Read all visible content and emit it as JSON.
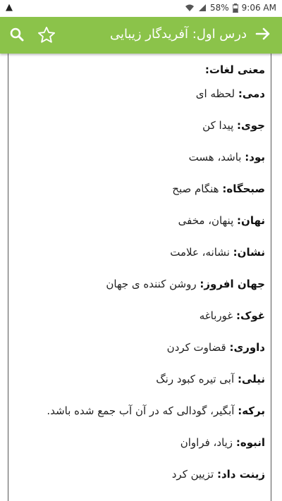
{
  "status_bar": {
    "battery": "58%",
    "time": "9:06 AM"
  },
  "app_bar": {
    "title": "درس اول: آفریدگار زیبایی",
    "color": "#8bc34a"
  },
  "content": {
    "heading": "معنی لغات:",
    "entries": [
      {
        "term": "دمی:",
        "meaning": "لحظه ای"
      },
      {
        "term": "جوی:",
        "meaning": "پیدا کن"
      },
      {
        "term": "بود:",
        "meaning": "باشد، هست"
      },
      {
        "term": "صبحگاه:",
        "meaning": "هنگام صبح"
      },
      {
        "term": "نهان:",
        "meaning": "پنهان، مخفی"
      },
      {
        "term": "نشان:",
        "meaning": "نشانه، علامت"
      },
      {
        "term": "جهان افروز:",
        "meaning": "روشن کننده ی جهان"
      },
      {
        "term": "غوک:",
        "meaning": "غورباغه"
      },
      {
        "term": "داوری:",
        "meaning": "قضاوت کردن"
      },
      {
        "term": "نیلی:",
        "meaning": "آبی تیره کبود رنگ"
      },
      {
        "term": "برکه:",
        "meaning": "آبگیر، گودالی که در آن آب جمع شده باشد."
      },
      {
        "term": "انبوه:",
        "meaning": "زیاد، فراوان"
      },
      {
        "term": "زینت داد:",
        "meaning": "تزیین کرد"
      }
    ]
  }
}
